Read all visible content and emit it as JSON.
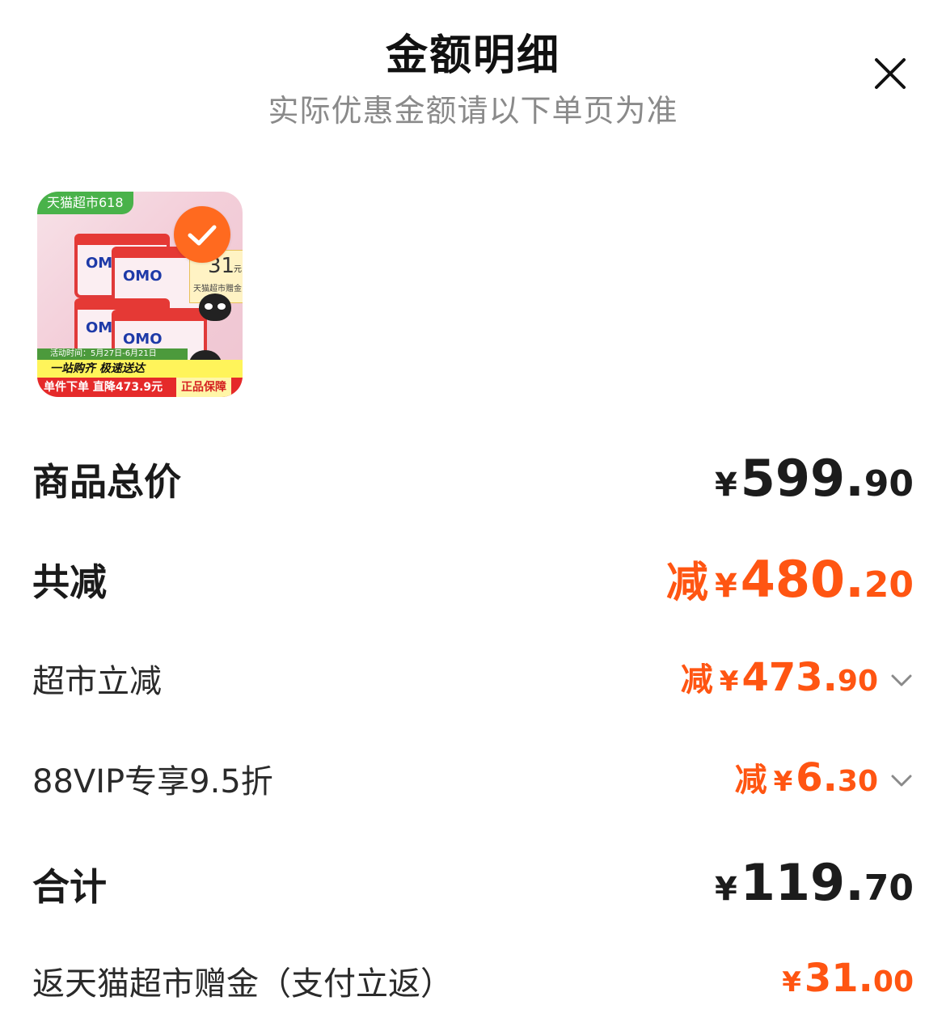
{
  "header": {
    "title": "金额明细",
    "subtitle": "实际优惠金额请以下单页为准"
  },
  "product": {
    "brand_tag": "天猫超市618",
    "pack_logo": "OMO",
    "rebate_num": "31",
    "rebate_unit": "元",
    "rebate_label": "天猫超市赠金",
    "promo_date": "活动时间：5月27日-6月21日",
    "slogan": "一站购齐 极速送达",
    "bottom_left": "单件下单 直降473.9元",
    "bottom_right": "正品保障",
    "selected": true
  },
  "rows": {
    "total": {
      "label": "商品总价",
      "yen": "¥",
      "int": "599.",
      "dec": "90"
    },
    "discount": {
      "label": "共减",
      "prefix": "减",
      "yen": "¥",
      "int": "480.",
      "dec": "20"
    },
    "supermarket": {
      "label": "超市立减",
      "prefix": "减",
      "yen": "¥",
      "int": "473.",
      "dec": "90"
    },
    "vip": {
      "label": "88VIP专享9.5折",
      "prefix": "减",
      "yen": "¥",
      "int": "6.",
      "dec": "30"
    },
    "sum": {
      "label": "合计",
      "yen": "¥",
      "int": "119.",
      "dec": "70"
    },
    "rebate": {
      "label": "返天猫超市赠金（支付立返）",
      "yen": "¥",
      "int": "31.",
      "dec": "00"
    }
  },
  "colors": {
    "accent": "#ff5512",
    "text": "#1c1c1c",
    "subtitle": "#8a8a8a"
  },
  "icons": {
    "close": "close-icon",
    "check": "check-icon",
    "chevron": "chevron-down-icon"
  }
}
